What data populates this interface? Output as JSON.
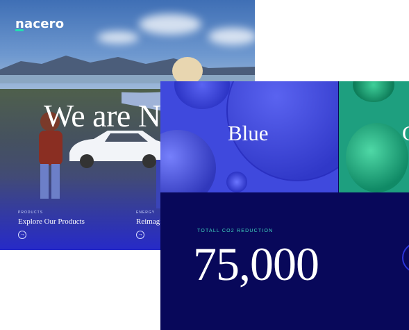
{
  "brand": {
    "logo_text": "nacero",
    "accent": "#22e0b0"
  },
  "hero": {
    "headline": "We are Na",
    "columns": [
      {
        "label": "PRODUCTS",
        "link": "Explore Our Products"
      },
      {
        "label": "ENERGY",
        "link": "Reimaginin"
      }
    ]
  },
  "front_card": {
    "tiles": [
      {
        "label": "Blue",
        "color": "#3f49dd"
      },
      {
        "label": "G",
        "color": "#1e9f7f"
      }
    ],
    "stat_label": "TOTALL CO2 REDUCTION",
    "stat_value": "75,000",
    "background": "#08085a"
  },
  "icons": {
    "arrow": "arrow-right-icon"
  }
}
